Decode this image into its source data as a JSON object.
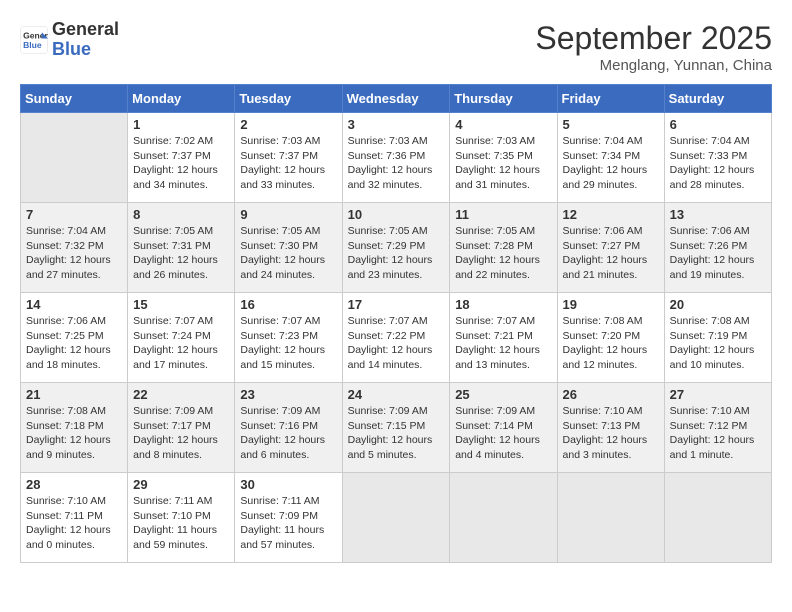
{
  "logo": {
    "line1": "General",
    "line2": "Blue"
  },
  "title": "September 2025",
  "location": "Menglang, Yunnan, China",
  "days_of_week": [
    "Sunday",
    "Monday",
    "Tuesday",
    "Wednesday",
    "Thursday",
    "Friday",
    "Saturday"
  ],
  "weeks": [
    [
      {
        "day": "",
        "info": ""
      },
      {
        "day": "1",
        "info": "Sunrise: 7:02 AM\nSunset: 7:37 PM\nDaylight: 12 hours\nand 34 minutes."
      },
      {
        "day": "2",
        "info": "Sunrise: 7:03 AM\nSunset: 7:37 PM\nDaylight: 12 hours\nand 33 minutes."
      },
      {
        "day": "3",
        "info": "Sunrise: 7:03 AM\nSunset: 7:36 PM\nDaylight: 12 hours\nand 32 minutes."
      },
      {
        "day": "4",
        "info": "Sunrise: 7:03 AM\nSunset: 7:35 PM\nDaylight: 12 hours\nand 31 minutes."
      },
      {
        "day": "5",
        "info": "Sunrise: 7:04 AM\nSunset: 7:34 PM\nDaylight: 12 hours\nand 29 minutes."
      },
      {
        "day": "6",
        "info": "Sunrise: 7:04 AM\nSunset: 7:33 PM\nDaylight: 12 hours\nand 28 minutes."
      }
    ],
    [
      {
        "day": "7",
        "info": "Sunrise: 7:04 AM\nSunset: 7:32 PM\nDaylight: 12 hours\nand 27 minutes."
      },
      {
        "day": "8",
        "info": "Sunrise: 7:05 AM\nSunset: 7:31 PM\nDaylight: 12 hours\nand 26 minutes."
      },
      {
        "day": "9",
        "info": "Sunrise: 7:05 AM\nSunset: 7:30 PM\nDaylight: 12 hours\nand 24 minutes."
      },
      {
        "day": "10",
        "info": "Sunrise: 7:05 AM\nSunset: 7:29 PM\nDaylight: 12 hours\nand 23 minutes."
      },
      {
        "day": "11",
        "info": "Sunrise: 7:05 AM\nSunset: 7:28 PM\nDaylight: 12 hours\nand 22 minutes."
      },
      {
        "day": "12",
        "info": "Sunrise: 7:06 AM\nSunset: 7:27 PM\nDaylight: 12 hours\nand 21 minutes."
      },
      {
        "day": "13",
        "info": "Sunrise: 7:06 AM\nSunset: 7:26 PM\nDaylight: 12 hours\nand 19 minutes."
      }
    ],
    [
      {
        "day": "14",
        "info": "Sunrise: 7:06 AM\nSunset: 7:25 PM\nDaylight: 12 hours\nand 18 minutes."
      },
      {
        "day": "15",
        "info": "Sunrise: 7:07 AM\nSunset: 7:24 PM\nDaylight: 12 hours\nand 17 minutes."
      },
      {
        "day": "16",
        "info": "Sunrise: 7:07 AM\nSunset: 7:23 PM\nDaylight: 12 hours\nand 15 minutes."
      },
      {
        "day": "17",
        "info": "Sunrise: 7:07 AM\nSunset: 7:22 PM\nDaylight: 12 hours\nand 14 minutes."
      },
      {
        "day": "18",
        "info": "Sunrise: 7:07 AM\nSunset: 7:21 PM\nDaylight: 12 hours\nand 13 minutes."
      },
      {
        "day": "19",
        "info": "Sunrise: 7:08 AM\nSunset: 7:20 PM\nDaylight: 12 hours\nand 12 minutes."
      },
      {
        "day": "20",
        "info": "Sunrise: 7:08 AM\nSunset: 7:19 PM\nDaylight: 12 hours\nand 10 minutes."
      }
    ],
    [
      {
        "day": "21",
        "info": "Sunrise: 7:08 AM\nSunset: 7:18 PM\nDaylight: 12 hours\nand 9 minutes."
      },
      {
        "day": "22",
        "info": "Sunrise: 7:09 AM\nSunset: 7:17 PM\nDaylight: 12 hours\nand 8 minutes."
      },
      {
        "day": "23",
        "info": "Sunrise: 7:09 AM\nSunset: 7:16 PM\nDaylight: 12 hours\nand 6 minutes."
      },
      {
        "day": "24",
        "info": "Sunrise: 7:09 AM\nSunset: 7:15 PM\nDaylight: 12 hours\nand 5 minutes."
      },
      {
        "day": "25",
        "info": "Sunrise: 7:09 AM\nSunset: 7:14 PM\nDaylight: 12 hours\nand 4 minutes."
      },
      {
        "day": "26",
        "info": "Sunrise: 7:10 AM\nSunset: 7:13 PM\nDaylight: 12 hours\nand 3 minutes."
      },
      {
        "day": "27",
        "info": "Sunrise: 7:10 AM\nSunset: 7:12 PM\nDaylight: 12 hours\nand 1 minute."
      }
    ],
    [
      {
        "day": "28",
        "info": "Sunrise: 7:10 AM\nSunset: 7:11 PM\nDaylight: 12 hours\nand 0 minutes."
      },
      {
        "day": "29",
        "info": "Sunrise: 7:11 AM\nSunset: 7:10 PM\nDaylight: 11 hours\nand 59 minutes."
      },
      {
        "day": "30",
        "info": "Sunrise: 7:11 AM\nSunset: 7:09 PM\nDaylight: 11 hours\nand 57 minutes."
      },
      {
        "day": "",
        "info": ""
      },
      {
        "day": "",
        "info": ""
      },
      {
        "day": "",
        "info": ""
      },
      {
        "day": "",
        "info": ""
      }
    ]
  ]
}
